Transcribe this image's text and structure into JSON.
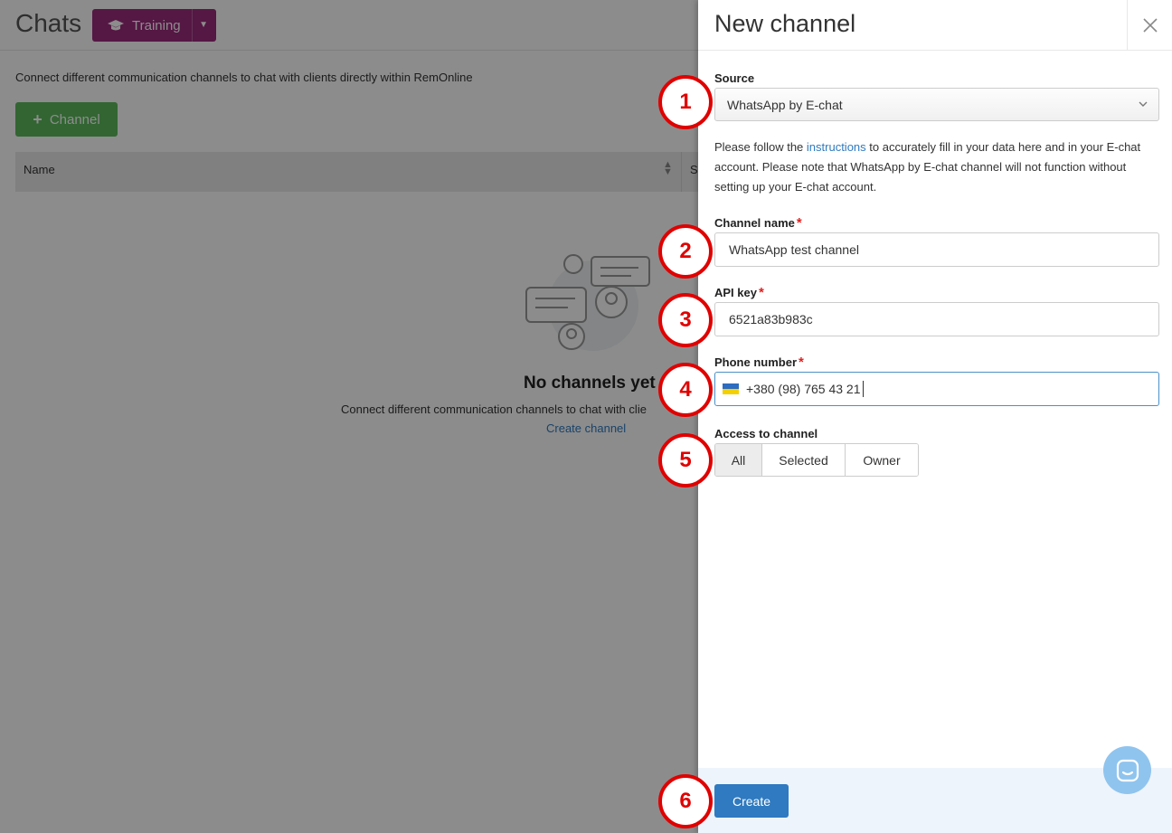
{
  "background": {
    "title": "Chats",
    "training_label": "Training",
    "description": "Connect different communication channels to chat with clients directly within RemOnline",
    "add_channel_label": "Channel",
    "table": {
      "col_name": "Name",
      "col_second_fragment": "S"
    },
    "empty": {
      "title": "No channels yet",
      "text": "Connect different communication channels to chat with clie",
      "link": "Create channel"
    }
  },
  "panel": {
    "title": "New channel",
    "source": {
      "label": "Source",
      "value": "WhatsApp by E-chat"
    },
    "note": {
      "before": "Please follow the ",
      "link": "instructions",
      "after": " to accurately fill in your data here and in your E-chat account. Please note that WhatsApp by E-chat channel will not function without setting up your E-chat account."
    },
    "channel_name": {
      "label": "Channel name",
      "value": "WhatsApp test channel"
    },
    "api_key": {
      "label": "API key",
      "value": "6521a83b983c"
    },
    "phone": {
      "label": "Phone number",
      "value": "+380 (98) 765 43 21"
    },
    "access": {
      "label": "Access to channel",
      "options": [
        "All",
        "Selected",
        "Owner"
      ],
      "selected": "All"
    },
    "required_mark": "*",
    "create_label": "Create"
  },
  "steps": [
    "1",
    "2",
    "3",
    "4",
    "5",
    "6"
  ],
  "colors": {
    "training": "#9c2a7c",
    "add_channel": "#5cb85c",
    "primary": "#2f7ac0",
    "required": "#e02020",
    "annotation": "#e00000"
  }
}
